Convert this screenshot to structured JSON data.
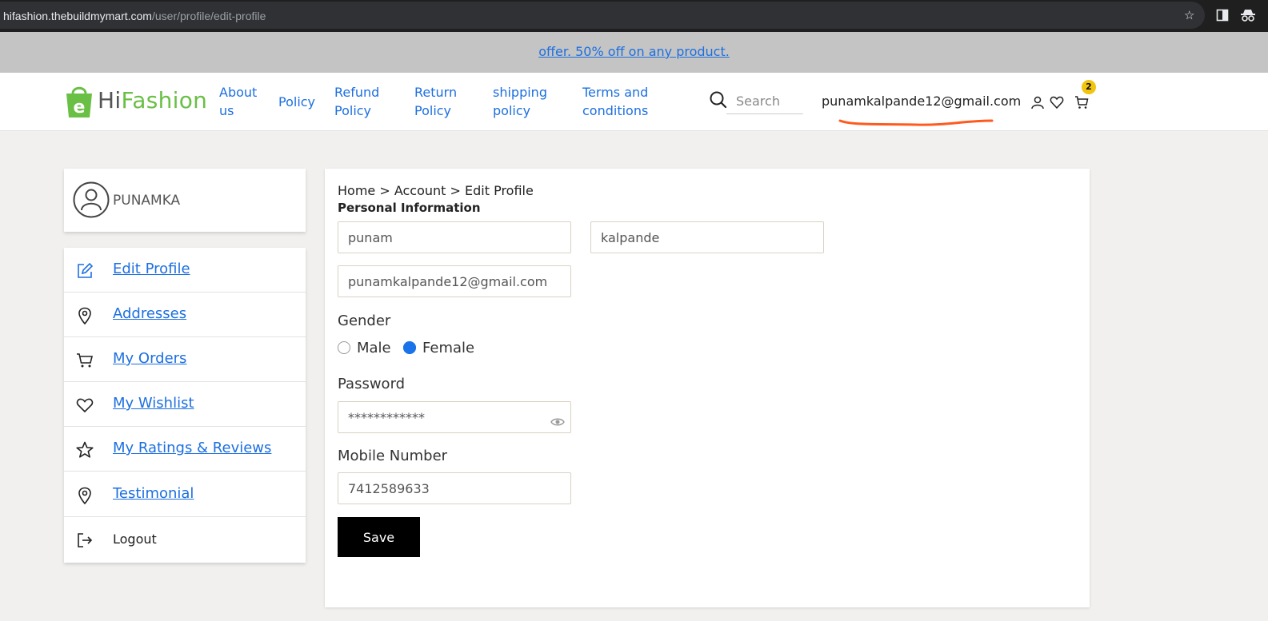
{
  "browser": {
    "url_host": "hifashion.thebuildmymart.com",
    "url_path": "/user/profile/edit-profile"
  },
  "offer_bar": {
    "text": "offer. 50% off on any product."
  },
  "header": {
    "logo_hi": "Hi",
    "logo_fashion": "Fashion",
    "nav": [
      {
        "line1": "About",
        "line2": "us"
      },
      {
        "line1": "Policy",
        "line2": ""
      },
      {
        "line1": "Refund",
        "line2": "Policy"
      },
      {
        "line1": "Return",
        "line2": "Policy"
      },
      {
        "line1": "shipping",
        "line2": "policy"
      },
      {
        "line1": "Terms and",
        "line2": "conditions"
      }
    ],
    "search_placeholder": "Search",
    "user_email": "punamkalpande12@gmail.com",
    "cart_count": "2",
    "icons": [
      "search-icon",
      "user-icon",
      "heart-icon",
      "cart-icon"
    ]
  },
  "sidebar": {
    "profile_name": "PUNAMKA",
    "items": [
      {
        "label": "Edit Profile",
        "icon": "edit-icon"
      },
      {
        "label": "Addresses",
        "icon": "location-pin-icon"
      },
      {
        "label": "My Orders",
        "icon": "cart-icon"
      },
      {
        "label": "My Wishlist",
        "icon": "heart-icon"
      },
      {
        "label": "My Ratings & Reviews",
        "icon": "star-icon"
      },
      {
        "label": "Testimonial",
        "icon": "location-pin-icon"
      },
      {
        "label": "Logout",
        "icon": "logout-icon"
      }
    ]
  },
  "main": {
    "breadcrumb": "Home > Account > Edit Profile",
    "section_title": "Personal Information",
    "first_name": "punam",
    "last_name": "kalpande",
    "email": "punamkalpande12@gmail.com",
    "gender_label": "Gender",
    "gender_options": [
      "Male",
      "Female"
    ],
    "gender_selected": "Female",
    "password_label": "Password",
    "password_value": "************",
    "mobile_label": "Mobile Number",
    "mobile_value": "7412589633",
    "save_label": "Save"
  },
  "colors": {
    "link": "#1d6fe0",
    "brand_green": "#6abf45",
    "annotation": "#ff5a1f",
    "badge": "#f1c40f"
  }
}
